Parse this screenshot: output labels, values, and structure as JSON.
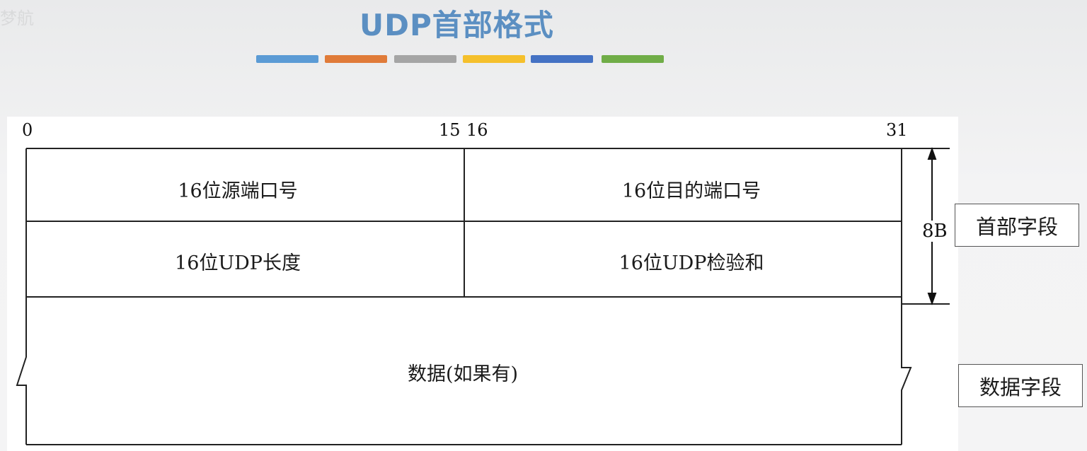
{
  "watermark": "梦航",
  "title": "UDP首部格式",
  "color_strip": [
    "#5b9bd5",
    "#e07b39",
    "#a5a5a5",
    "#f5c02c",
    "#4472c4",
    "#70ad47"
  ],
  "bit_numbers": {
    "start": "0",
    "mid_end": "15",
    "mid_start": "16",
    "end": "31"
  },
  "fields": {
    "source_port": "16位源端口号",
    "dest_port": "16位目的端口号",
    "length": "16位UDP长度",
    "checksum": "16位UDP检验和",
    "data": "数据(如果有)"
  },
  "header_size": "8B",
  "side_labels": {
    "header_field": "首部字段",
    "data_field": "数据字段"
  }
}
